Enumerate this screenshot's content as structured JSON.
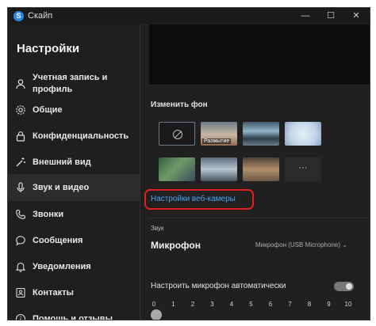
{
  "window": {
    "title": "Скайп",
    "logo_letter": "S",
    "controls": {
      "minimize": "—",
      "maximize": "☐",
      "close": "✕"
    }
  },
  "sidebar": {
    "title": "Настройки",
    "items": [
      {
        "icon": "user-icon",
        "label_line1": "Учетная запись и",
        "label_line2": "профиль"
      },
      {
        "icon": "gear-icon",
        "label": "Общие"
      },
      {
        "icon": "lock-icon",
        "label": "Конфиденциальность"
      },
      {
        "icon": "wand-icon",
        "label": "Внешний вид"
      },
      {
        "icon": "microphone-icon",
        "label": "Звук и видео",
        "active": true
      },
      {
        "icon": "phone-icon",
        "label": "Звонки"
      },
      {
        "icon": "chat-icon",
        "label": "Сообщения"
      },
      {
        "icon": "bell-icon",
        "label": "Уведомления"
      },
      {
        "icon": "contacts-icon",
        "label": "Контакты"
      },
      {
        "icon": "info-icon",
        "label": "Помощь и отзывы"
      }
    ]
  },
  "main": {
    "background_section_title": "Изменить фон",
    "blur_label": "Размытие",
    "more_label": "···",
    "webcam_settings_link": "Настройки веб-камеры",
    "sound_section_title": "Звук",
    "microphone_label": "Микрофон",
    "microphone_select": "Микрофон (USB Microphone) ⌄",
    "auto_adjust_label": "Настроить микрофон автоматически",
    "auto_adjust_enabled": true,
    "volume_ticks": [
      "0",
      "1",
      "2",
      "3",
      "4",
      "5",
      "6",
      "7",
      "8",
      "9",
      "10"
    ],
    "volume_level": 0
  },
  "colors": {
    "accent_link": "#4aa3f0",
    "highlight_border": "#e0201f",
    "window_bg": "#202020",
    "selected_nav_bg": "#2c2c2c"
  }
}
